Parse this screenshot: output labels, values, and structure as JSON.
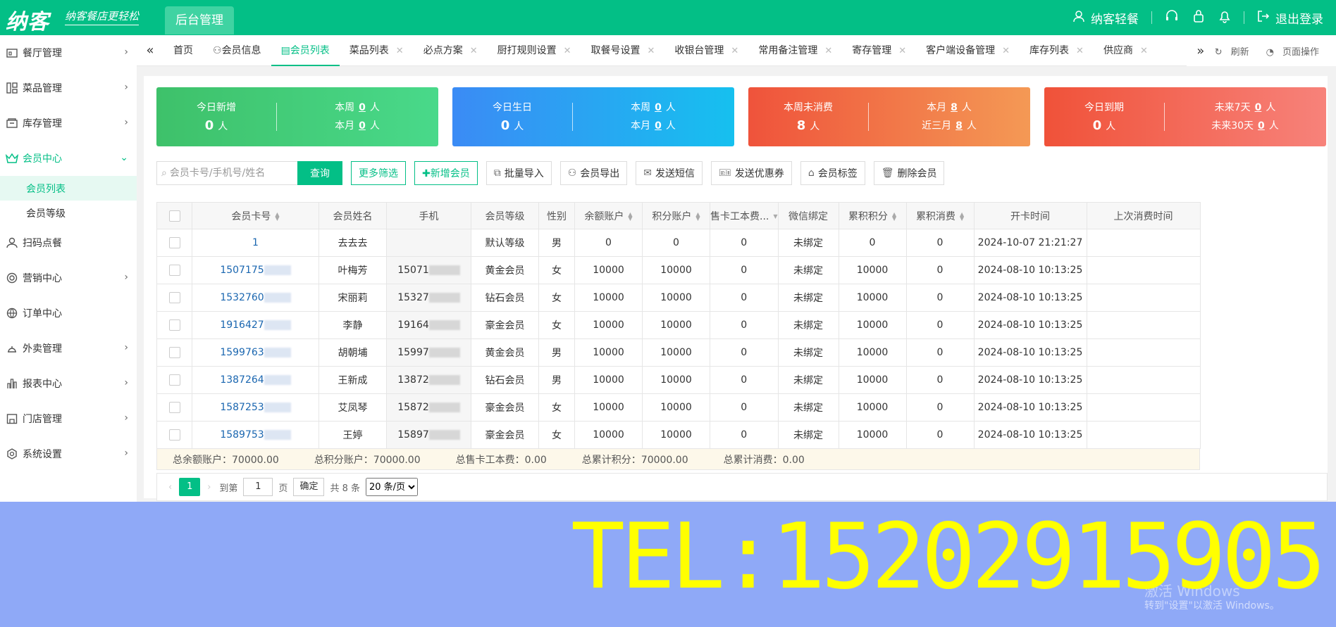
{
  "header": {
    "logo": "纳客",
    "slogan": "纳客餐店更轻松",
    "admin_tab": "后台管理",
    "user": "纳客轻餐",
    "logout": "退出登录"
  },
  "sidebar": {
    "items": [
      {
        "label": "餐厅管理",
        "icon": "store-icon"
      },
      {
        "label": "菜品管理",
        "icon": "dishes-icon"
      },
      {
        "label": "库存管理",
        "icon": "inventory-icon"
      },
      {
        "label": "会员中心",
        "icon": "crown-icon"
      },
      {
        "label": "扫码点餐",
        "icon": "user-icon"
      },
      {
        "label": "营销中心",
        "icon": "target-icon"
      },
      {
        "label": "订单中心",
        "icon": "globe-icon"
      },
      {
        "label": "外卖管理",
        "icon": "delivery-icon"
      },
      {
        "label": "报表中心",
        "icon": "report-icon"
      },
      {
        "label": "门店管理",
        "icon": "shop-icon"
      },
      {
        "label": "系统设置",
        "icon": "gear-icon"
      }
    ],
    "sub_items": [
      "会员列表",
      "会员等级"
    ]
  },
  "tabs": {
    "items": [
      "首页",
      "会员信息",
      "会员列表",
      "菜品列表",
      "必点方案",
      "厨打规则设置",
      "取餐号设置",
      "收银台管理",
      "常用备注管理",
      "寄存管理",
      "客户端设备管理",
      "库存列表",
      "供应商"
    ],
    "refresh": "刷新",
    "page_ops": "页面操作"
  },
  "cards": [
    {
      "title": "今日新增",
      "value": "0",
      "unit": "人",
      "rows": [
        {
          "label": "本周",
          "value": "0",
          "unit": "人"
        },
        {
          "label": "本月",
          "value": "0",
          "unit": "人"
        }
      ]
    },
    {
      "title": "今日生日",
      "value": "0",
      "unit": "人",
      "rows": [
        {
          "label": "本周",
          "value": "0",
          "unit": "人"
        },
        {
          "label": "本月",
          "value": "0",
          "unit": "人"
        }
      ]
    },
    {
      "title": "本周未消费",
      "value": "8",
      "unit": "人",
      "rows": [
        {
          "label": "本月",
          "value": "8",
          "unit": "人"
        },
        {
          "label": "近三月",
          "value": "8",
          "unit": "人"
        }
      ]
    },
    {
      "title": "今日到期",
      "value": "0",
      "unit": "人",
      "rows": [
        {
          "label": "未来7天",
          "value": "0",
          "unit": "人"
        },
        {
          "label": "未来30天",
          "value": "0",
          "unit": "人"
        }
      ]
    }
  ],
  "toolbar": {
    "search_placeholder": "会员卡号/手机号/姓名",
    "query": "查询",
    "more_filter": "更多筛选",
    "add_member": "✚新增会员",
    "batch_import": "批量导入",
    "export": "会员导出",
    "sms": "发送短信",
    "coupon": "发送优惠券",
    "tags": "会员标签",
    "delete": "删除会员"
  },
  "table": {
    "headers": [
      "会员卡号",
      "会员姓名",
      "手机",
      "会员等级",
      "性别",
      "余额账户",
      "积分账户",
      "售卡工本费...",
      "微信绑定",
      "累积积分",
      "累积消费",
      "开卡时间",
      "上次消费时间"
    ],
    "rows": [
      [
        "1",
        "去去去",
        "",
        "默认等级",
        "男",
        "0",
        "0",
        "0",
        "未绑定",
        "0",
        "0",
        "2024-10-07 21:21:27",
        ""
      ],
      [
        "1507175",
        "叶梅芳",
        "15071",
        "黄金会员",
        "女",
        "10000",
        "10000",
        "0",
        "未绑定",
        "10000",
        "0",
        "2024-08-10 10:13:25",
        ""
      ],
      [
        "1532760",
        "宋丽莉",
        "15327",
        "钻石会员",
        "女",
        "10000",
        "10000",
        "0",
        "未绑定",
        "10000",
        "0",
        "2024-08-10 10:13:25",
        ""
      ],
      [
        "1916427",
        "李静",
        "19164",
        "豪金会员",
        "女",
        "10000",
        "10000",
        "0",
        "未绑定",
        "10000",
        "0",
        "2024-08-10 10:13:25",
        ""
      ],
      [
        "1599763",
        "胡朝埔",
        "15997",
        "黄金会员",
        "男",
        "10000",
        "10000",
        "0",
        "未绑定",
        "10000",
        "0",
        "2024-08-10 10:13:25",
        ""
      ],
      [
        "1387264",
        "王新成",
        "13872",
        "钻石会员",
        "男",
        "10000",
        "10000",
        "0",
        "未绑定",
        "10000",
        "0",
        "2024-08-10 10:13:25",
        ""
      ],
      [
        "1587253",
        "艾凤琴",
        "15872",
        "豪金会员",
        "女",
        "10000",
        "10000",
        "0",
        "未绑定",
        "10000",
        "0",
        "2024-08-10 10:13:25",
        ""
      ],
      [
        "1589753",
        "王婷",
        "15897",
        "豪金会员",
        "女",
        "10000",
        "10000",
        "0",
        "未绑定",
        "10000",
        "0",
        "2024-08-10 10:13:25",
        ""
      ]
    ],
    "totals": [
      "总余额账户：70000.00",
      "总积分账户：70000.00",
      "总售卡工本费：0.00",
      "总累计积分：70000.00",
      "总累计消费：0.00"
    ]
  },
  "pager": {
    "page": "1",
    "goto": "到第",
    "page_input": "1",
    "page_unit": "页",
    "confirm": "确定",
    "total": "共 8 条",
    "page_size": "20 条/页"
  },
  "overlay": {
    "tel": "TEL:15202915905",
    "win1": "激活 Windows",
    "win2": "转到\"设置\"以激活 Windows。"
  },
  "colors": {
    "brand": "#03bf86",
    "overlay": "#8fa9f7",
    "tel": "#ffff00"
  }
}
